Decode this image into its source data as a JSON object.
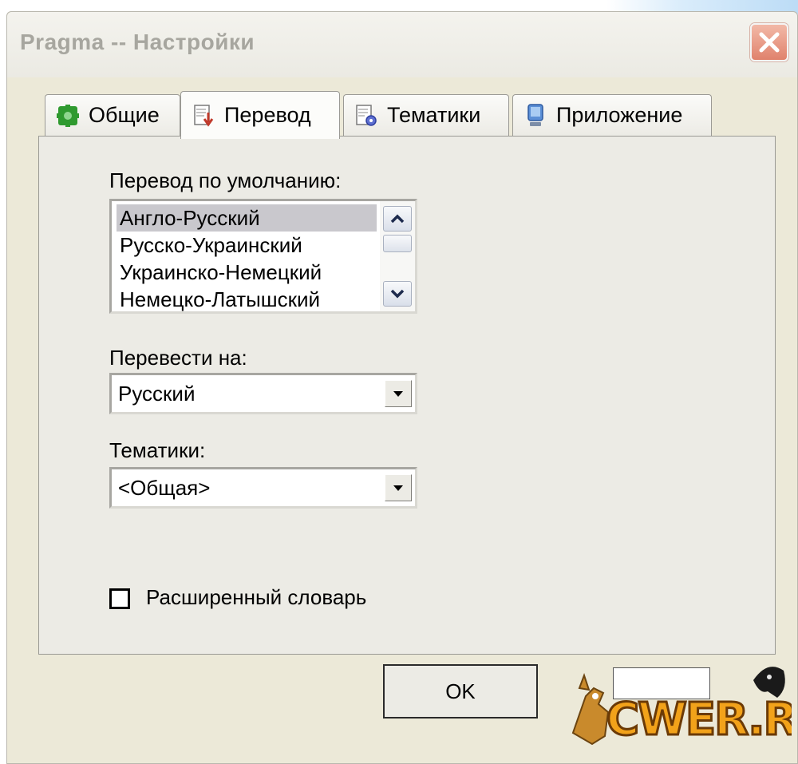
{
  "window": {
    "title": "Pragma -- Настройки"
  },
  "tabs": [
    {
      "label": "Общие",
      "icon": "gear-puzzle-icon",
      "active": false
    },
    {
      "label": "Перевод",
      "icon": "document-arrow-icon",
      "active": true
    },
    {
      "label": "Тематики",
      "icon": "document-gear-icon",
      "active": false
    },
    {
      "label": "Приложение",
      "icon": "computer-icon",
      "active": false
    }
  ],
  "translation": {
    "default_label": "Перевод по умолчанию:",
    "default_options": [
      "Англо-Русский",
      "Русско-Украинский",
      "Украинско-Немецкий",
      "Немецко-Латышский"
    ],
    "selected_index": 0,
    "translate_to_label": "Перевести на:",
    "translate_to_value": "Русский",
    "topics_label": "Тематики:",
    "topics_value": "<Общая>",
    "extended_dict_label": "Расширенный словарь",
    "extended_dict_checked": false
  },
  "footer": {
    "ok_label": "OK"
  },
  "watermark": {
    "text": "CWER.RU"
  },
  "colors": {
    "dialog_bg": "#ece9d8",
    "title_text": "#a7a69f",
    "close_button": "#e0826c",
    "selected_item": "#c9c8cd"
  }
}
